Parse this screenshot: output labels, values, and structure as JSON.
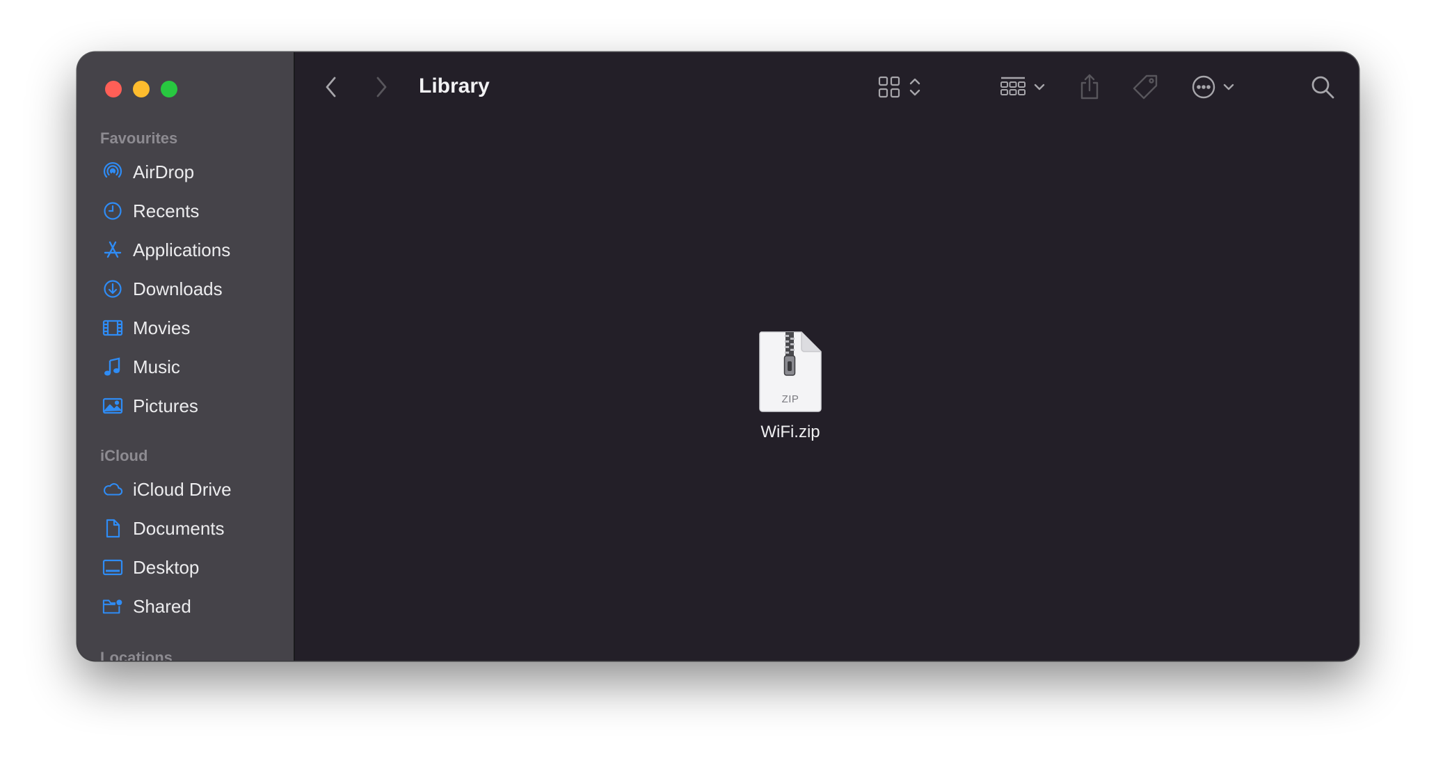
{
  "window": {
    "traffic_lights": {
      "close": "#ff5f57",
      "minimize": "#febc2e",
      "zoom": "#28c840"
    }
  },
  "sidebar": {
    "sections": [
      {
        "header": "Favourites",
        "items": [
          {
            "label": "AirDrop",
            "icon": "airdrop-icon"
          },
          {
            "label": "Recents",
            "icon": "clock-icon"
          },
          {
            "label": "Applications",
            "icon": "applications-icon"
          },
          {
            "label": "Downloads",
            "icon": "download-icon"
          },
          {
            "label": "Movies",
            "icon": "film-icon"
          },
          {
            "label": "Music",
            "icon": "music-note-icon"
          },
          {
            "label": "Pictures",
            "icon": "photo-icon"
          }
        ]
      },
      {
        "header": "iCloud",
        "items": [
          {
            "label": "iCloud Drive",
            "icon": "cloud-icon"
          },
          {
            "label": "Documents",
            "icon": "document-icon"
          },
          {
            "label": "Desktop",
            "icon": "desktop-icon"
          },
          {
            "label": "Shared",
            "icon": "shared-folder-icon"
          }
        ]
      },
      {
        "header": "Locations",
        "items": []
      }
    ],
    "accent_color": "#2f8cf5"
  },
  "toolbar": {
    "title": "Library",
    "buttons": [
      "back",
      "forward",
      "view-mode",
      "group",
      "share",
      "tag",
      "more-actions",
      "search"
    ]
  },
  "content": {
    "files": [
      {
        "name": "WiFi.zip",
        "icon_label": "ZIP"
      }
    ]
  }
}
